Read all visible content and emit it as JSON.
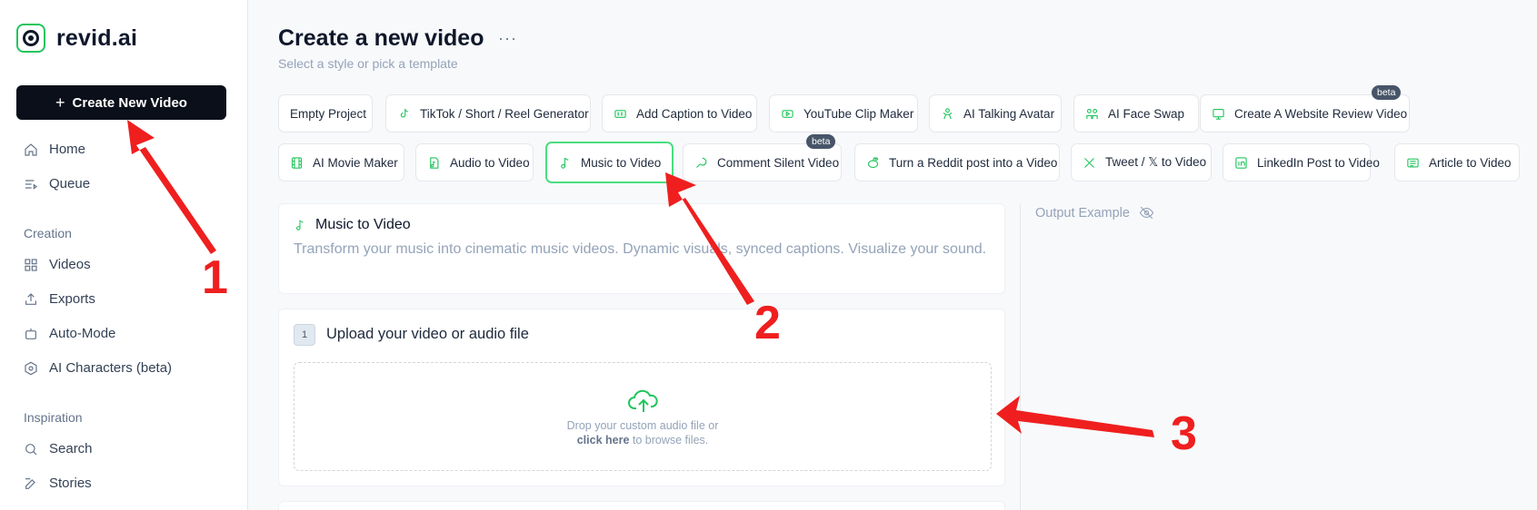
{
  "brand": {
    "name": "revid.ai"
  },
  "sidebar": {
    "create_label": "Create New Video",
    "nav": [
      {
        "label": "Home",
        "icon": "home-icon"
      },
      {
        "label": "Queue",
        "icon": "queue-icon"
      }
    ],
    "creation_label": "Creation",
    "creation_items": [
      {
        "label": "Videos",
        "icon": "grid-icon"
      },
      {
        "label": "Exports",
        "icon": "export-icon"
      },
      {
        "label": "Auto-Mode",
        "icon": "robot-icon"
      },
      {
        "label": "AI Characters (beta)",
        "icon": "hexagon-icon"
      }
    ],
    "inspiration_label": "Inspiration",
    "inspiration_items": [
      {
        "label": "Search",
        "icon": "search-icon"
      },
      {
        "label": "Stories",
        "icon": "edit-icon"
      }
    ]
  },
  "header": {
    "title": "Create a new video",
    "more": "···",
    "subtitle": "Select a style or pick a template"
  },
  "templates_row1": [
    {
      "label": "Empty Project",
      "icon": ""
    },
    {
      "label": "TikTok / Short / Reel Generator",
      "icon": "tiktok-icon"
    },
    {
      "label": "Add Caption to Video",
      "icon": "caption-icon"
    },
    {
      "label": "YouTube Clip Maker",
      "icon": "youtube-icon"
    },
    {
      "label": "AI Talking Avatar",
      "icon": "avatar-icon"
    },
    {
      "label": "AI Face Swap",
      "icon": "face-swap-icon"
    },
    {
      "label": "Create A Website Review Video",
      "icon": "monitor-icon",
      "badge": "beta"
    }
  ],
  "templates_row2": [
    {
      "label": "AI Movie Maker",
      "icon": "film-icon"
    },
    {
      "label": "Audio to Video",
      "icon": "audio-file-icon"
    },
    {
      "label": "Music to Video",
      "icon": "music-note-icon",
      "active": true
    },
    {
      "label": "Comment Silent Video",
      "icon": "comment-icon",
      "badge": "beta"
    },
    {
      "label": "Turn a Reddit post into a Video",
      "icon": "reddit-icon"
    },
    {
      "label": "Tweet / 𝕏 to Video",
      "icon": "x-icon"
    },
    {
      "label": "LinkedIn Post to Video",
      "icon": "linkedin-icon"
    },
    {
      "label": "Article to Video",
      "icon": "article-icon"
    }
  ],
  "selected": {
    "title": "Music to Video",
    "description": "Transform your music into cinematic music videos. Dynamic visuals, synced captions. Visualize your sound."
  },
  "upload": {
    "step": "1",
    "title": "Upload your video or audio file",
    "drop_line1": "Drop your custom audio file or",
    "drop_link": "click here",
    "drop_line2_rest": " to browse files."
  },
  "output": {
    "label": "Output Example"
  },
  "annotations": [
    "1",
    "2",
    "3"
  ],
  "colors": {
    "accent": "#22c55e",
    "dark": "#0b0f19",
    "annotation": "#ef1f1f"
  }
}
